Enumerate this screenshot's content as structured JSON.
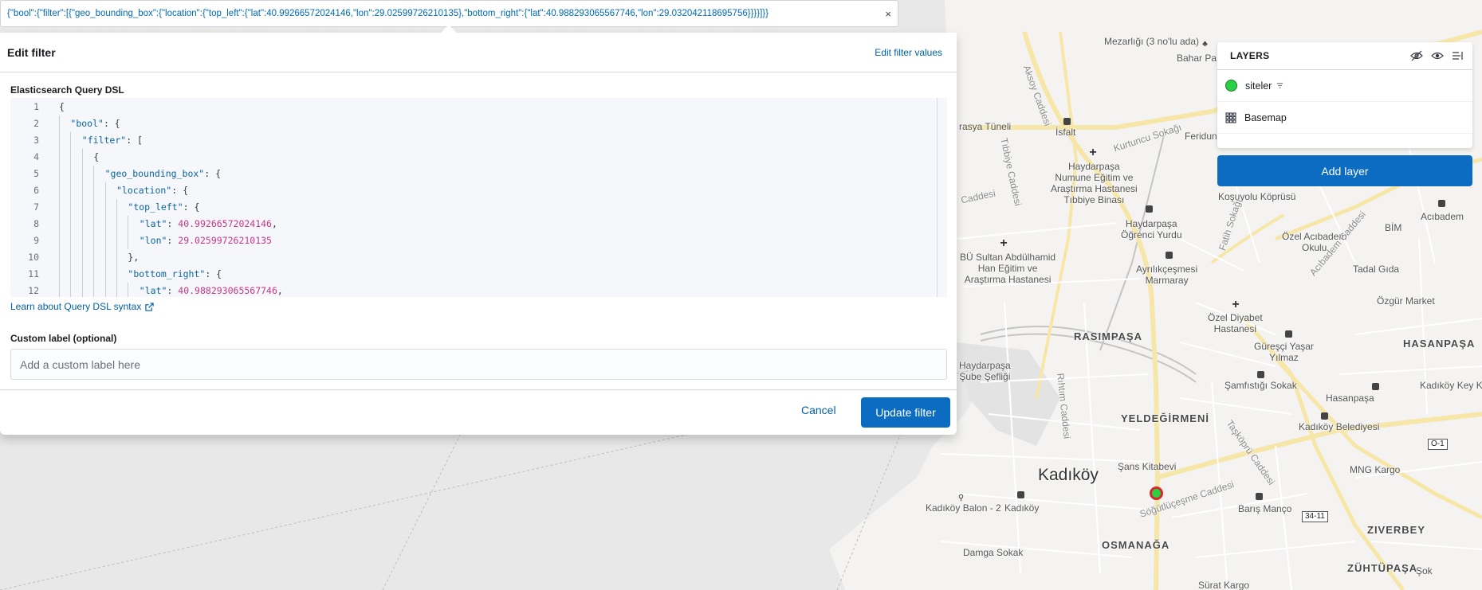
{
  "filter_pill": {
    "text": "{\"bool\":{\"filter\":[{\"geo_bounding_box\":{\"location\":{\"top_left\":{\"lat\":40.99266572024146,\"lon\":29.02599726210135},\"bottom_right\":{\"lat\":40.988293065567746,\"lon\":29.032042118695756}}}}]}}",
    "close_icon": "×"
  },
  "edit_filter": {
    "title": "Edit filter",
    "edit_values_link": "Edit filter values",
    "dsl_label": "Elasticsearch Query DSL",
    "code_lines": [
      {
        "no": "1",
        "indent": 0,
        "parts": [
          [
            "p",
            "{"
          ]
        ]
      },
      {
        "no": "2",
        "indent": 1,
        "parts": [
          [
            "k",
            "\"bool\""
          ],
          [
            "p",
            ": {"
          ]
        ]
      },
      {
        "no": "3",
        "indent": 2,
        "parts": [
          [
            "k",
            "\"filter\""
          ],
          [
            "p",
            ": ["
          ]
        ]
      },
      {
        "no": "4",
        "indent": 3,
        "parts": [
          [
            "p",
            "{"
          ]
        ]
      },
      {
        "no": "5",
        "indent": 4,
        "parts": [
          [
            "k",
            "\"geo_bounding_box\""
          ],
          [
            "p",
            ": {"
          ]
        ]
      },
      {
        "no": "6",
        "indent": 5,
        "parts": [
          [
            "k",
            "\"location\""
          ],
          [
            "p",
            ": {"
          ]
        ]
      },
      {
        "no": "7",
        "indent": 6,
        "parts": [
          [
            "k",
            "\"top_left\""
          ],
          [
            "p",
            ": {"
          ]
        ]
      },
      {
        "no": "8",
        "indent": 7,
        "parts": [
          [
            "k",
            "\"lat\""
          ],
          [
            "p",
            ": "
          ],
          [
            "n",
            "40.99266572024146"
          ],
          [
            "p",
            ","
          ]
        ]
      },
      {
        "no": "9",
        "indent": 7,
        "parts": [
          [
            "k",
            "\"lon\""
          ],
          [
            "p",
            ": "
          ],
          [
            "n",
            "29.02599726210135"
          ]
        ]
      },
      {
        "no": "10",
        "indent": 6,
        "parts": [
          [
            "p",
            "},"
          ]
        ]
      },
      {
        "no": "11",
        "indent": 6,
        "parts": [
          [
            "k",
            "\"bottom_right\""
          ],
          [
            "p",
            ": {"
          ]
        ]
      },
      {
        "no": "12",
        "indent": 7,
        "parts": [
          [
            "k",
            "\"lat\""
          ],
          [
            "p",
            ": "
          ],
          [
            "n",
            "40.988293065567746"
          ],
          [
            "p",
            ","
          ]
        ]
      }
    ],
    "learn_link": "Learn about Query DSL syntax",
    "custom_label": "Custom label (optional)",
    "custom_label_placeholder": "Add a custom label here",
    "custom_label_value": "",
    "cancel": "Cancel",
    "update": "Update filter"
  },
  "layers": {
    "title": "LAYERS",
    "items": [
      {
        "name": "siteler",
        "type": "points",
        "color": "#2bd046",
        "has_filter": true
      },
      {
        "name": "Basemap",
        "type": "basemap"
      }
    ],
    "add_layer": "Add layer"
  },
  "map": {
    "labels": {
      "mezarligi": "Mezarlığı (3 no'lu ada)",
      "bahar": "Bahar Pa",
      "aksoy": "Aksoy Caddesi",
      "tunel": "rasya Tüneli",
      "isfalt": "İsfalt",
      "kurtuncu": "Kurtuncu Sokağı",
      "feridun": "Feridun",
      "tibbiye": "Tıbbiye Caddesi",
      "hospital1": "Haydarpaşa\nNumune Eğitim ve\nAraştırma Hastanesi\nTıbbiye Binası",
      "kosuyolu": "Koşuyolu Köprüsü",
      "dere": "Caddesi",
      "acibadem_top": "Acıbadem",
      "ogrenci": "Haydarpaşa\nÖğrenci Yurdu",
      "ozel_acibadem": "Özel Acıbadem\nOkulu",
      "bim": "BİM",
      "sultan": "BÜ Sultan Abdülhamid\nHan Eğitim ve\nAraştırma Hastanesi",
      "ayrilik": "Ayrılıkçeşmesi\nMarmaray",
      "fatih": "Fatih Sokağı",
      "acibadem_cad": "Acıbadem Caddesi",
      "tadal": "Tadal Gıda",
      "ozgur": "Özgür Market",
      "diyabet": "Özel Diyabet\nHastanesi",
      "rasimpasa": "RASIMPAŞA",
      "guresci": "Güreşçi Yaşar\nYılmaz",
      "hasanpasa_d": "HASANPAŞA",
      "haydarpasa_sube": "Haydarpaşa\nŞube Şefliği",
      "samfistigi": "Şamfıstığı Sokak",
      "kadikoy_key": "Kadıköy Key Ko",
      "hasanpasa": "Hasanpaşa",
      "rihtim": "Rıhtım Caddesi",
      "yeldegirmeni": "YELDEĞİRMENİ",
      "taskopru": "Taşköprü Caddesi",
      "belediye": "Kadıköy Belediyesi",
      "o1": "O-1",
      "sans": "Şans Kitabevi",
      "mng": "MNG Kargo",
      "kadikoy": "Kadıköy",
      "sogutlu": "Söğütlüçeşme Caddesi",
      "balon": "Kadıköy Balon - 2",
      "kadikoy_small": "Kadıköy",
      "baris": "Barış Manço",
      "e3411": "34-11",
      "damga": "Damga Sokak",
      "osmanaga": "OSMANAĞA",
      "ziverbey": "ZIVERBEY",
      "zuhtupasa": "ZÜHTÜPAŞA",
      "surat": "Sürat Kargo",
      "sok": "Şok",
      "feneryolu": "Kadıköy"
    }
  },
  "colors": {
    "accent": "#0b6cc1",
    "link": "#0061a6",
    "marker_fill": "#2bd046",
    "marker_stroke": "#d8262c"
  }
}
